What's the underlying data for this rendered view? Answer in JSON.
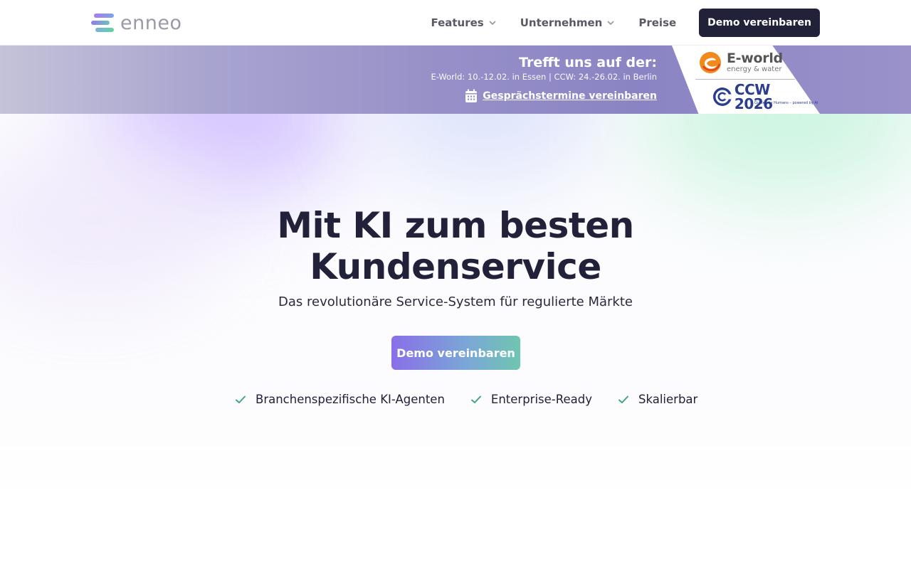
{
  "header": {
    "logo_text": "enneo",
    "nav": {
      "features": "Features",
      "company": "Unternehmen",
      "pricing": "Preise",
      "demo": "Demo vereinbaren"
    }
  },
  "banner": {
    "title": "Trefft uns auf der:",
    "subtitle": "E-World: 10.-12.02. in Essen | CCW: 24.-26.02. in Berlin",
    "link": "Gesprächstermine vereinbaren",
    "eworld_title": "E-world",
    "eworld_sub": "energy & water",
    "ccw_title": "CCW 2026",
    "ccw_tag": "Guided by Humans – powered by AI"
  },
  "hero": {
    "title_line1": "Mit KI zum besten",
    "title_line2": "Kundenservice",
    "subtitle": "Das revolutionäre Service-System für regulierte Märkte",
    "cta": "Demo vereinbaren",
    "features": [
      "Branchenspezifische KI-Agenten",
      "Enterprise-Ready",
      "Skalierbar"
    ]
  },
  "colors": {
    "primary_dark": "#22213a",
    "check_green": "#3fa77a",
    "banner_purple": "#8a84c4",
    "accent_purple": "#8a6fe8",
    "accent_teal": "#6fc6b0"
  },
  "icons": [
    "logo-mark-icon",
    "chevron-down-icon",
    "calendar-icon",
    "eworld-logo-icon",
    "ccw-logo-icon",
    "check-icon"
  ]
}
